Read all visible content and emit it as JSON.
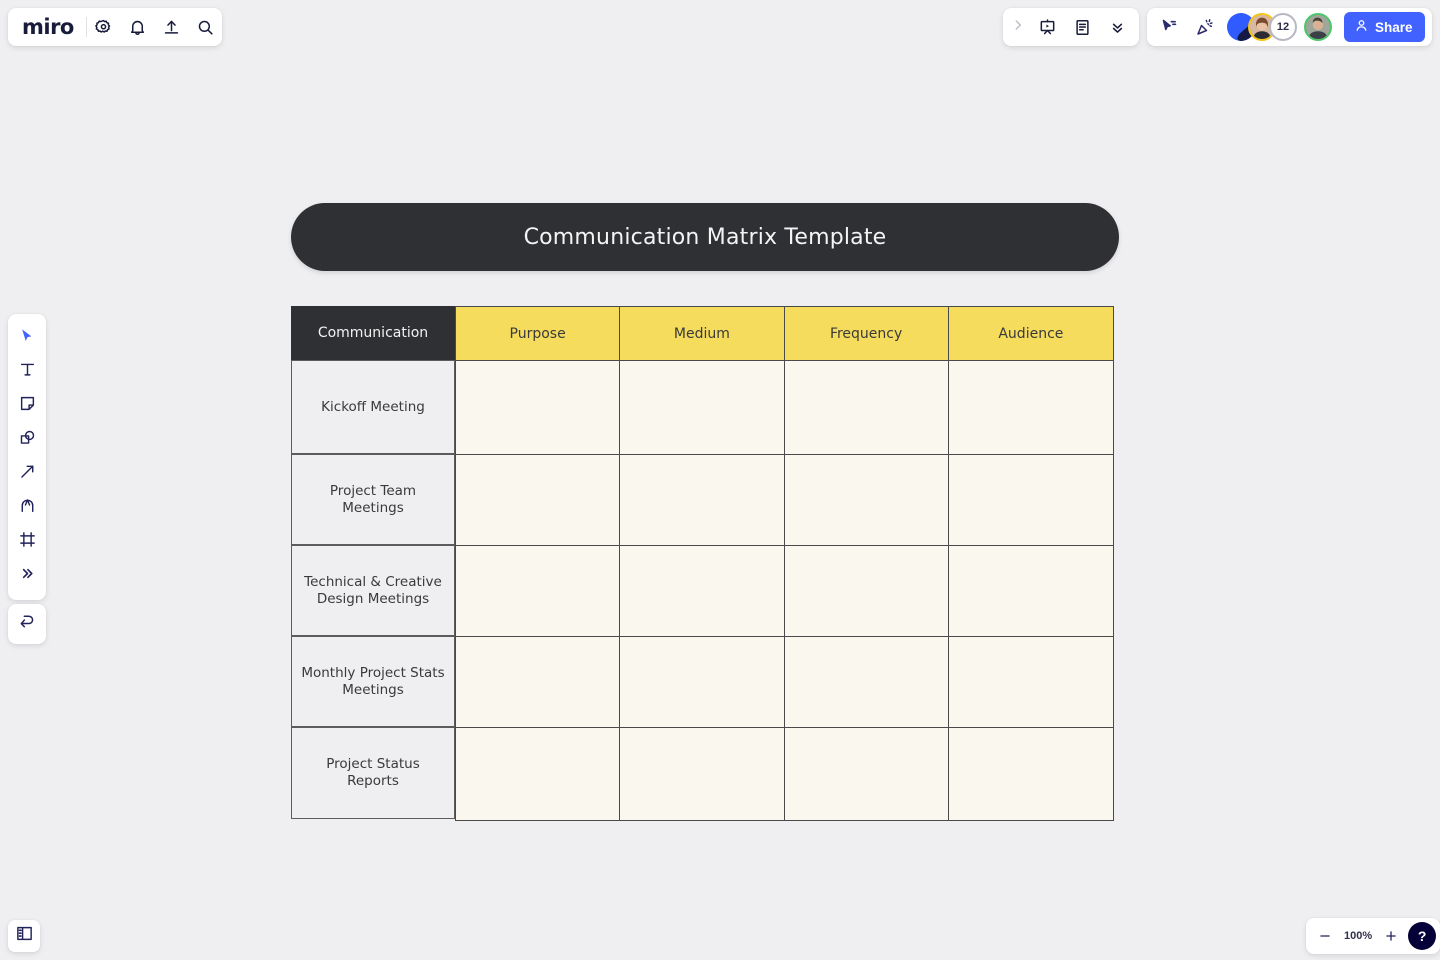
{
  "app": {
    "logo_text": "miro",
    "zoom_level": "100%"
  },
  "top_left_toolbar": {
    "items": [
      {
        "name": "settings-gear",
        "icon": "gear-icon"
      },
      {
        "name": "notifications",
        "icon": "bell-icon"
      },
      {
        "name": "upload",
        "icon": "upload-icon"
      },
      {
        "name": "search",
        "icon": "search-icon"
      }
    ]
  },
  "top_right_toolbar_a": {
    "items": [
      {
        "name": "expand",
        "icon": "chevron-right-icon"
      },
      {
        "name": "presentation-mode",
        "icon": "presentation-icon"
      },
      {
        "name": "notes",
        "icon": "document-icon"
      },
      {
        "name": "collapse",
        "icon": "double-chevron-down-icon"
      }
    ]
  },
  "top_right_toolbar_b": {
    "items": [
      {
        "name": "follow-cursor",
        "icon": "cursor-motion-icon"
      },
      {
        "name": "reactions",
        "icon": "confetti-icon"
      }
    ],
    "collaborators": {
      "count_badge": "12",
      "avatars": [
        "avatar-brand",
        "avatar-user-1",
        "avatar-user-2"
      ]
    },
    "share_label": "Share",
    "share_icon": "person-icon",
    "share_color": "#4262FF"
  },
  "left_toolbar": {
    "tools": [
      {
        "name": "select-tool",
        "icon": "cursor-icon",
        "selected": true
      },
      {
        "name": "text-tool",
        "icon": "text-icon",
        "selected": false
      },
      {
        "name": "sticky-note-tool",
        "icon": "sticky-note-icon",
        "selected": false
      },
      {
        "name": "shapes-tool",
        "icon": "shapes-icon",
        "selected": false
      },
      {
        "name": "connection-line-tool",
        "icon": "arrow-icon",
        "selected": false
      },
      {
        "name": "pen-tool",
        "icon": "pen-icon",
        "selected": false
      },
      {
        "name": "frame-tool",
        "icon": "frame-icon",
        "selected": false
      },
      {
        "name": "more-tools",
        "icon": "double-chevron-right-icon",
        "selected": false
      }
    ],
    "undo": {
      "name": "undo",
      "icon": "undo-arrow-icon"
    }
  },
  "bottom_left": {
    "panel_toggle": {
      "name": "toggle-side-panel",
      "icon": "panel-icon"
    }
  },
  "bottom_right": {
    "zoom_out_label": "−",
    "zoom_value": "100%",
    "zoom_in_label": "+",
    "help_label": "?"
  },
  "board": {
    "title": "Communication Matrix Template",
    "title_bg": "#2E3033",
    "header_bg": "#F5DC5C",
    "cell_bg": "#FAF7EF",
    "row_label_bg": "#EFEFF1",
    "matrix": {
      "corner_header": "Communication",
      "column_headers": [
        "Purpose",
        "Medium",
        "Frequency",
        "Audience"
      ],
      "rows": [
        {
          "label": "Kickoff Meeting",
          "cells": [
            "",
            "",
            "",
            ""
          ]
        },
        {
          "label": "Project Team Meetings",
          "cells": [
            "",
            "",
            "",
            ""
          ]
        },
        {
          "label": "Technical & Creative Design Meetings",
          "cells": [
            "",
            "",
            "",
            ""
          ]
        },
        {
          "label": "Monthly Project Stats Meetings",
          "cells": [
            "",
            "",
            "",
            ""
          ]
        },
        {
          "label": "Project Status Reports",
          "cells": [
            "",
            "",
            "",
            ""
          ]
        }
      ]
    }
  }
}
